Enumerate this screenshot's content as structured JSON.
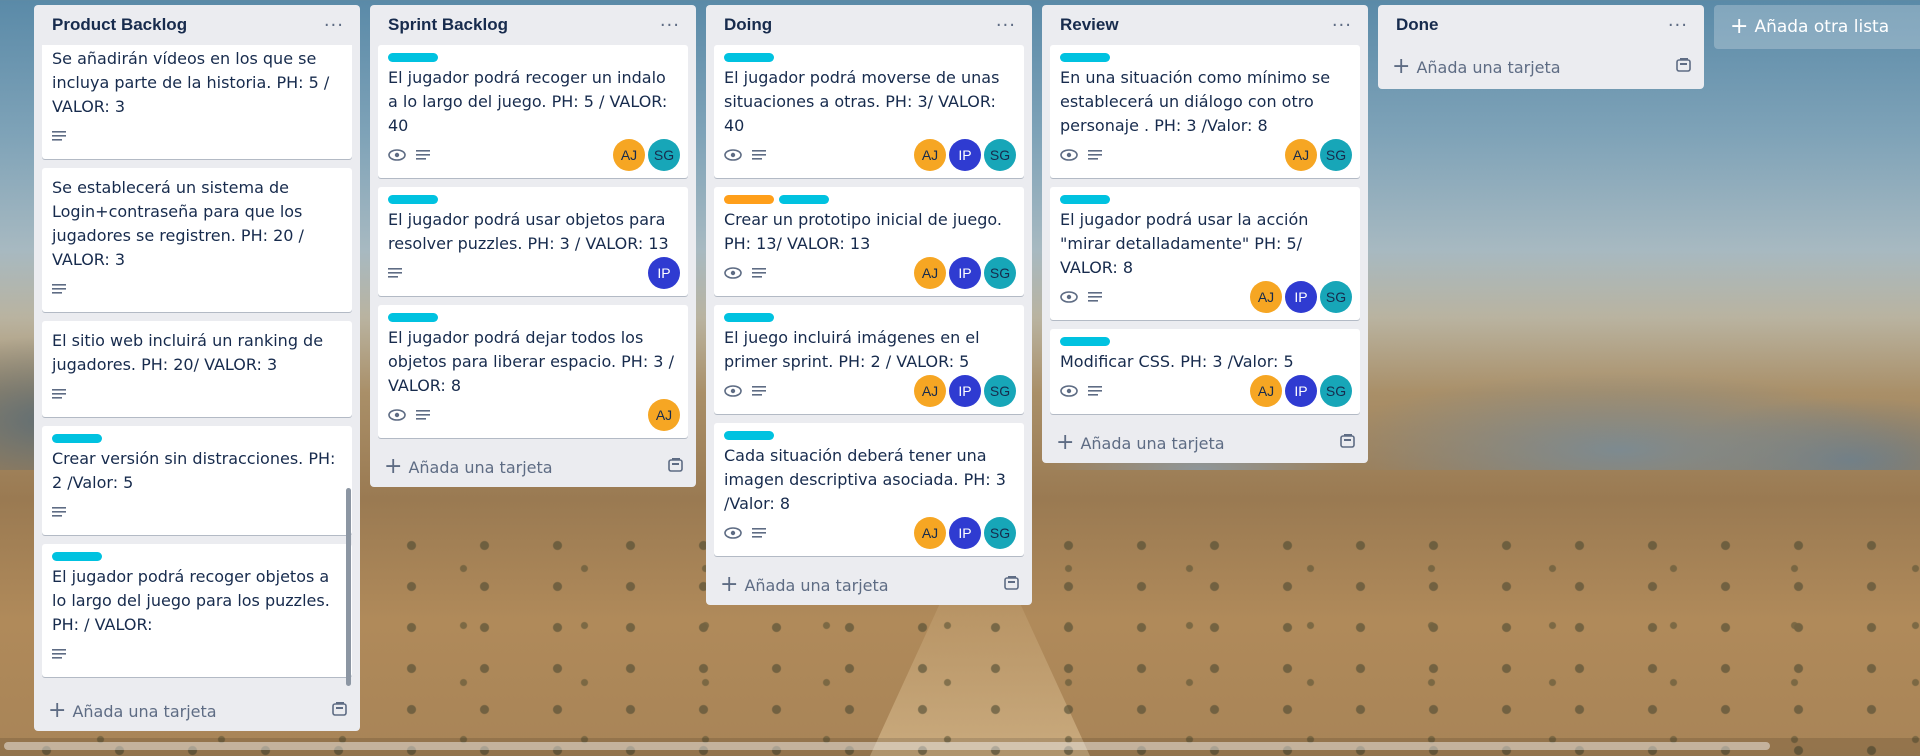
{
  "board": {
    "lists": [
      {
        "title": "Product Backlog",
        "add_card_label": "Añada una tarjeta",
        "cards": [
          {
            "text": "Se añadirán vídeos en los que se incluya parte de la historia. PH: 5 / VALOR: 3"
          },
          {
            "text": "Se establecerá un sistema de Login+contraseña para que los jugadores se registren. PH: 20 / VALOR: 3"
          },
          {
            "text": "El sitio web incluirá un ranking de jugadores. PH: 20/ VALOR: 3"
          },
          {
            "text": "Crear versión sin distracciones. PH: 2 /Valor: 5"
          },
          {
            "text": "El jugador podrá recoger objetos a lo largo del juego para los puzzles. PH: / VALOR:"
          }
        ]
      },
      {
        "title": "Sprint Backlog",
        "add_card_label": "Añada una tarjeta",
        "cards": [
          {
            "text": "El jugador podrá recoger un indalo a lo largo del juego. PH: 5 / VALOR: 40",
            "members": [
              "AJ",
              "SG"
            ]
          },
          {
            "text": "El jugador podrá usar objetos para resolver puzzles. PH: 3 / VALOR: 13",
            "members": [
              "IP"
            ]
          },
          {
            "text": "El jugador podrá dejar todos los objetos para liberar espacio. PH: 3 / VALOR: 8",
            "members": [
              "AJ"
            ]
          }
        ]
      },
      {
        "title": "Doing",
        "add_card_label": "Añada una tarjeta",
        "cards": [
          {
            "text": "El jugador podrá moverse de unas situaciones a otras. PH: 3/ VALOR: 40",
            "members": [
              "AJ",
              "IP",
              "SG"
            ]
          },
          {
            "text": "Crear un prototipo inicial de juego. PH: 13/ VALOR: 13",
            "members": [
              "AJ",
              "IP",
              "SG"
            ]
          },
          {
            "text": "El juego incluirá imágenes en el primer sprint. PH: 2 / VALOR: 5",
            "members": [
              "AJ",
              "IP",
              "SG"
            ]
          },
          {
            "text": "Cada situación deberá tener una imagen descriptiva asociada. PH: 3 /Valor: 8",
            "members": [
              "AJ",
              "IP",
              "SG"
            ]
          }
        ]
      },
      {
        "title": "Review",
        "add_card_label": "Añada una tarjeta",
        "cards": [
          {
            "text": "En una situación como mínimo se establecerá un diálogo con otro personaje . PH: 3 /Valor: 8",
            "members": [
              "AJ",
              "SG"
            ]
          },
          {
            "text": "El jugador podrá usar la acción \"mirar detalladamente\" PH: 5/ VALOR: 8",
            "members": [
              "AJ",
              "IP",
              "SG"
            ]
          },
          {
            "text": "Modificar CSS. PH: 3 /Valor: 5",
            "members": [
              "AJ",
              "IP",
              "SG"
            ]
          }
        ]
      },
      {
        "title": "Done",
        "add_card_label": "Añada una tarjeta",
        "cards": []
      }
    ],
    "add_list_label": "Añada otra lista"
  },
  "menu_glyph": "···",
  "colors": {
    "label_cyan": "#00c2e0",
    "label_orange": "#ff9f1a",
    "avatar_AJ": "#f6a623",
    "avatar_IP": "#2f3bd1",
    "avatar_SG": "#17a6b8"
  },
  "icons": {
    "watch": "eye-icon",
    "description": "description-icon",
    "template": "card-template-icon",
    "add": "plus-icon",
    "menu": "more-icon"
  }
}
